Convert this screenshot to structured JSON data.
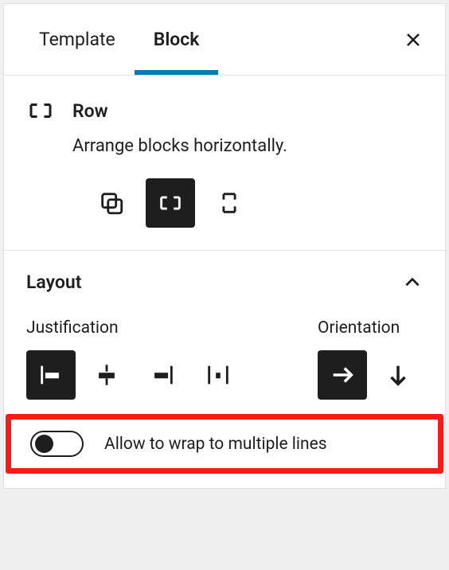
{
  "tabs": {
    "template": "Template",
    "block": "Block"
  },
  "block": {
    "name": "Row",
    "description": "Arrange blocks horizontally."
  },
  "layout": {
    "title": "Layout",
    "justification_label": "Justification",
    "orientation_label": "Orientation",
    "wrap_label": "Allow to wrap to multiple lines"
  }
}
